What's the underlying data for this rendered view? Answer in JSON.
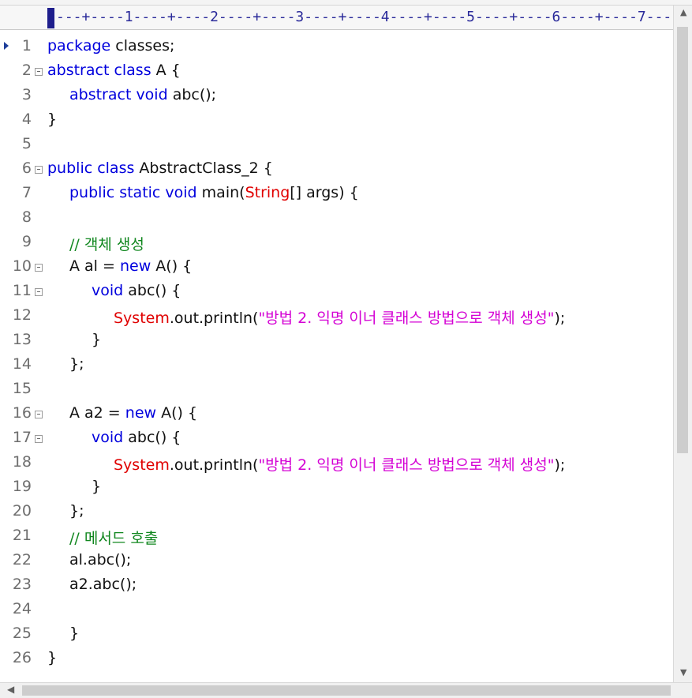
{
  "ruler": {
    "text": "---+----1----+----2----+----3----+----4----+----5----+----6----+----7---"
  },
  "icons": {
    "fold": "fold-minus-icon",
    "caret": "current-line-caret-icon"
  },
  "colors": {
    "keyword": "#0000dd",
    "class": "#e00000",
    "string": "#d400d4",
    "comment": "#11871f",
    "line_number": "#6e6e6e"
  },
  "lines": [
    {
      "num": "1",
      "fold": false,
      "indent": 0,
      "tokens": [
        [
          "kw",
          "package"
        ],
        [
          "p",
          " classes;"
        ]
      ]
    },
    {
      "num": "2",
      "fold": true,
      "indent": 0,
      "tokens": [
        [
          "kw",
          "abstract class"
        ],
        [
          "p",
          " A {"
        ]
      ]
    },
    {
      "num": "3",
      "fold": false,
      "indent": 1,
      "tokens": [
        [
          "kw",
          "abstract void"
        ],
        [
          "p",
          " abc();"
        ]
      ]
    },
    {
      "num": "4",
      "fold": false,
      "indent": 0,
      "tokens": [
        [
          "p",
          "}"
        ]
      ]
    },
    {
      "num": "5",
      "fold": false,
      "indent": 0,
      "tokens": []
    },
    {
      "num": "6",
      "fold": true,
      "indent": 0,
      "tokens": [
        [
          "kw",
          "public class"
        ],
        [
          "p",
          " AbstractClass_2 {"
        ]
      ]
    },
    {
      "num": "7",
      "fold": false,
      "indent": 1,
      "tokens": [
        [
          "kw",
          "public static void"
        ],
        [
          "p",
          " main("
        ],
        [
          "cls",
          "String"
        ],
        [
          "p",
          "[] args) {"
        ]
      ]
    },
    {
      "num": "8",
      "fold": false,
      "indent": 0,
      "tokens": []
    },
    {
      "num": "9",
      "fold": false,
      "indent": 1,
      "tokens": [
        [
          "cmt",
          "// 객체 생성"
        ]
      ]
    },
    {
      "num": "10",
      "fold": true,
      "indent": 1,
      "tokens": [
        [
          "p",
          "A al = "
        ],
        [
          "kw",
          "new"
        ],
        [
          "p",
          " A() {"
        ]
      ]
    },
    {
      "num": "11",
      "fold": true,
      "indent": 2,
      "tokens": [
        [
          "kw",
          "void"
        ],
        [
          "p",
          " abc() {"
        ]
      ]
    },
    {
      "num": "12",
      "fold": false,
      "indent": 3,
      "tokens": [
        [
          "cls",
          "System"
        ],
        [
          "p",
          ".out.println("
        ],
        [
          "str",
          "\"방법 2. 익명 이너 클래스 방법으로 객체 생성\""
        ],
        [
          "p",
          ");"
        ]
      ]
    },
    {
      "num": "13",
      "fold": false,
      "indent": 2,
      "tokens": [
        [
          "p",
          "}"
        ]
      ]
    },
    {
      "num": "14",
      "fold": false,
      "indent": 1,
      "tokens": [
        [
          "p",
          "};"
        ]
      ]
    },
    {
      "num": "15",
      "fold": false,
      "indent": 0,
      "tokens": []
    },
    {
      "num": "16",
      "fold": true,
      "indent": 1,
      "tokens": [
        [
          "p",
          "A a2 = "
        ],
        [
          "kw",
          "new"
        ],
        [
          "p",
          " A() {"
        ]
      ]
    },
    {
      "num": "17",
      "fold": true,
      "indent": 2,
      "tokens": [
        [
          "kw",
          "void"
        ],
        [
          "p",
          " abc() {"
        ]
      ]
    },
    {
      "num": "18",
      "fold": false,
      "indent": 3,
      "tokens": [
        [
          "cls",
          "System"
        ],
        [
          "p",
          ".out.println("
        ],
        [
          "str",
          "\"방법 2. 익명 이너 클래스 방법으로 객체 생성\""
        ],
        [
          "p",
          ");"
        ]
      ]
    },
    {
      "num": "19",
      "fold": false,
      "indent": 2,
      "tokens": [
        [
          "p",
          "}"
        ]
      ]
    },
    {
      "num": "20",
      "fold": false,
      "indent": 1,
      "tokens": [
        [
          "p",
          "};"
        ]
      ]
    },
    {
      "num": "21",
      "fold": false,
      "indent": 1,
      "tokens": [
        [
          "cmt",
          "// 메서드 호출"
        ]
      ]
    },
    {
      "num": "22",
      "fold": false,
      "indent": 1,
      "tokens": [
        [
          "p",
          "al.abc();"
        ]
      ]
    },
    {
      "num": "23",
      "fold": false,
      "indent": 1,
      "tokens": [
        [
          "p",
          "a2.abc();"
        ]
      ]
    },
    {
      "num": "24",
      "fold": false,
      "indent": 0,
      "tokens": []
    },
    {
      "num": "25",
      "fold": false,
      "indent": 1,
      "tokens": [
        [
          "p",
          "}"
        ]
      ]
    },
    {
      "num": "26",
      "fold": false,
      "indent": 0,
      "tokens": [
        [
          "p",
          "}"
        ]
      ]
    }
  ]
}
